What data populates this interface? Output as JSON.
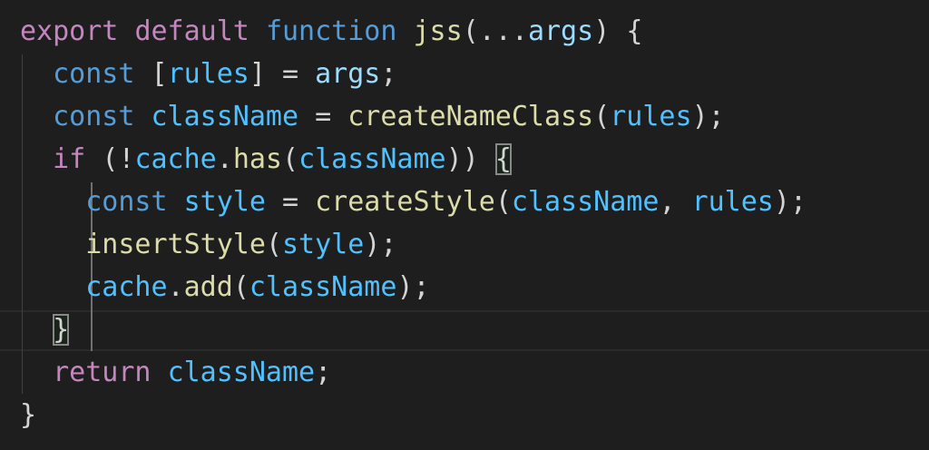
{
  "code": {
    "l1": {
      "export": "export",
      "default": "default",
      "function": "function",
      "name": "jss",
      "open": "(",
      "spread": "...",
      "args": "args",
      "close": ")",
      "brace": "{"
    },
    "l2": {
      "const": "const",
      "lb": "[",
      "rules": "rules",
      "rb": "]",
      "eq": "=",
      "args": "args",
      "semi": ";"
    },
    "l3": {
      "const": "const",
      "className": "className",
      "eq": "=",
      "fn": "createNameClass",
      "open": "(",
      "rules": "rules",
      "close": ")",
      "semi": ";"
    },
    "l4": {
      "if": "if",
      "open": "(",
      "not": "!",
      "cache": "cache",
      "dot": ".",
      "has": "has",
      "open2": "(",
      "className": "className",
      "close2": ")",
      "close": ")",
      "brace": "{"
    },
    "l5": {
      "const": "const",
      "style": "style",
      "eq": "=",
      "fn": "createStyle",
      "open": "(",
      "className": "className",
      "comma": ",",
      "rules": "rules",
      "close": ")",
      "semi": ";"
    },
    "l6": {
      "fn": "insertStyle",
      "open": "(",
      "style": "style",
      "close": ")",
      "semi": ";"
    },
    "l7": {
      "cache": "cache",
      "dot": ".",
      "add": "add",
      "open": "(",
      "className": "className",
      "close": ")",
      "semi": ";"
    },
    "l8": {
      "brace": "}"
    },
    "l9": {
      "return": "return",
      "className": "className",
      "semi": ";"
    },
    "l10": {
      "brace": "}"
    }
  },
  "colors": {
    "background": "#1e1e1e",
    "keyword_control": "#c586c0",
    "keyword_declaration": "#569cd6",
    "function": "#dcdcaa",
    "variable": "#9cdcfe",
    "constant": "#4fc1ff",
    "punctuation": "#d4d4d4"
  }
}
